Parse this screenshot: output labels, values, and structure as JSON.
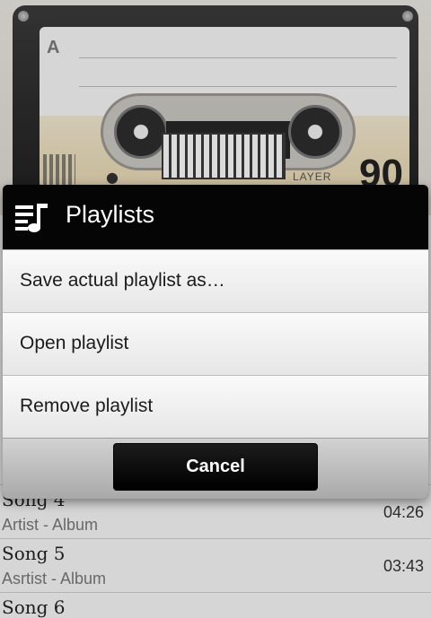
{
  "cassette": {
    "side_letter": "A",
    "player_label": "LAYER",
    "tape_number": "90"
  },
  "songs": [
    {
      "title": "Song 4",
      "subtitle": "Artist - Album",
      "duration": "04:26"
    },
    {
      "title": "Song 5",
      "subtitle": "Asrtist - Album",
      "duration": "03:43"
    },
    {
      "title": "Song 6",
      "subtitle": "",
      "duration": ""
    }
  ],
  "dialog": {
    "title": "Playlists",
    "icon": "playlist-icon",
    "items": [
      {
        "label": "Save actual playlist as…"
      },
      {
        "label": "Open playlist"
      },
      {
        "label": "Remove playlist"
      }
    ],
    "cancel_label": "Cancel"
  },
  "colors": {
    "header_bg": "#050505",
    "menu_bg": "#f2f2f2",
    "button_bg": "#0a0a0a"
  }
}
